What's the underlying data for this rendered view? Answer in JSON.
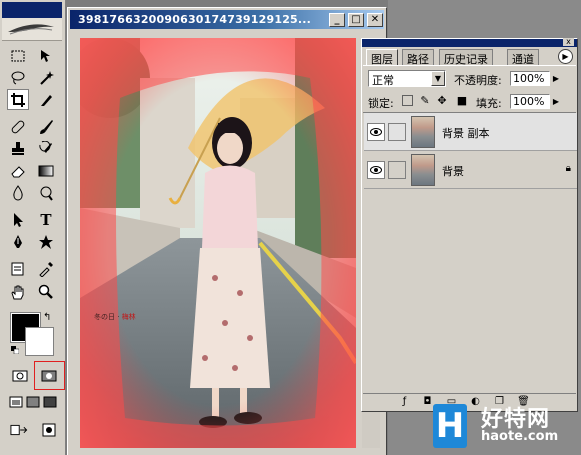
{
  "image_window": {
    "title": "3981766320090630174739129125...",
    "buttons": [
      "_",
      "□",
      "✕"
    ]
  },
  "photo": {
    "caption_prefix": "冬の日 ·",
    "caption_highlight": "梅林"
  },
  "toolbox": {
    "text_tool_glyph": "T",
    "foreground_color": "#000000",
    "background_color": "#ffffff"
  },
  "layers_palette": {
    "tabs": [
      "图层",
      "路径",
      "历史记录",
      "通道"
    ],
    "active_tab": "图层",
    "blend_mode": "正常",
    "opacity_label": "不透明度:",
    "opacity_value": "100%",
    "lock_label": "锁定:",
    "fill_label": "填充:",
    "fill_value": "100%",
    "layers": [
      {
        "name": "背景 副本",
        "selected": true,
        "locked": false
      },
      {
        "name": "背景",
        "selected": false,
        "locked": true
      }
    ]
  },
  "watermark": {
    "logo_letter": "H",
    "name": "好特网",
    "url": "haote.com"
  }
}
